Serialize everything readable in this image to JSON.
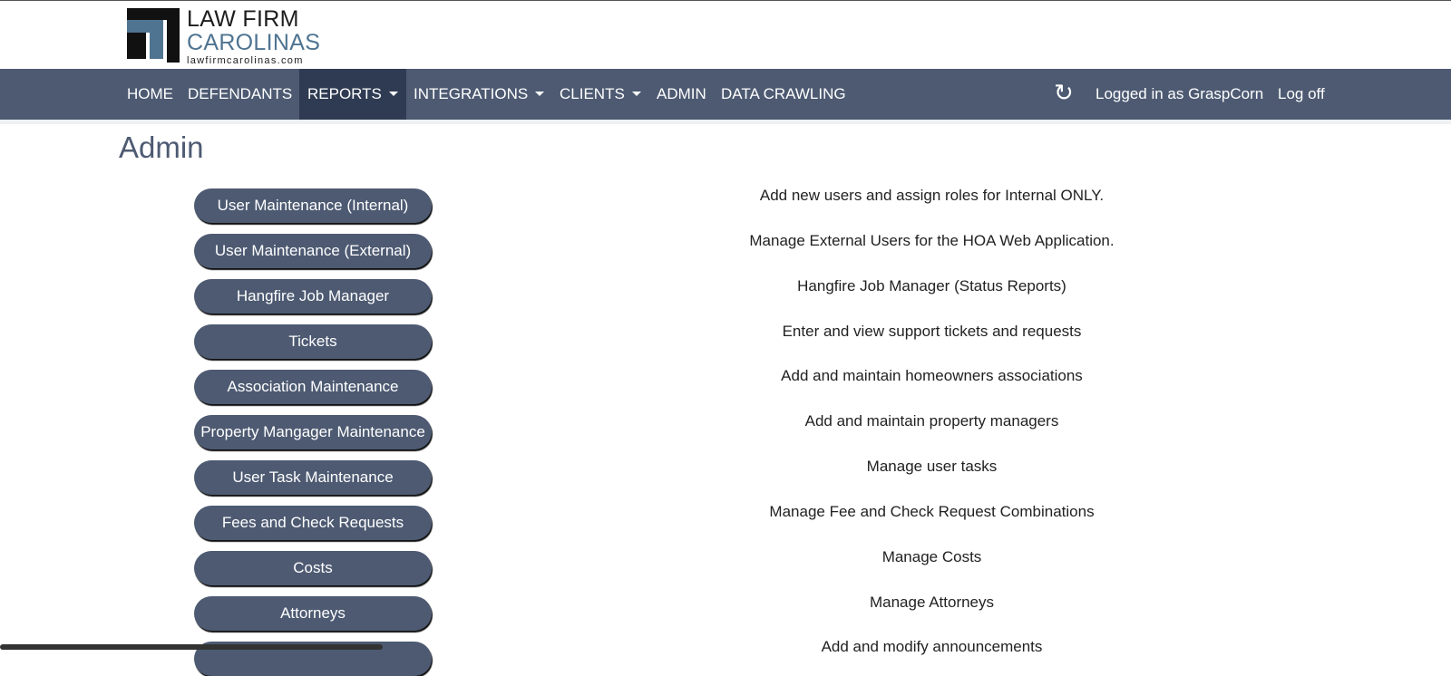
{
  "logo": {
    "line1": "LAW FIRM",
    "line2": "CAROLINAS",
    "line3": "lawfirmcarolinas.com"
  },
  "nav": {
    "items": [
      {
        "label": "HOME"
      },
      {
        "label": "DEFENDANTS"
      },
      {
        "label": "REPORTS"
      },
      {
        "label": "INTEGRATIONS"
      },
      {
        "label": "CLIENTS"
      },
      {
        "label": "ADMIN"
      },
      {
        "label": "DATA CRAWLING"
      }
    ],
    "refresh_icon": "↻",
    "logged_in": "Logged in as GraspCorn",
    "logoff": "Log off"
  },
  "page": {
    "title": "Admin"
  },
  "admin": {
    "rows": [
      {
        "button": "User Maintenance (Internal)",
        "description": "Add new users and assign roles for Internal ONLY."
      },
      {
        "button": "User Maintenance (External)",
        "description": "Manage External Users for the HOA Web Application."
      },
      {
        "button": "Hangfire Job Manager",
        "description": "Hangfire Job Manager (Status Reports)"
      },
      {
        "button": "Tickets",
        "description": "Enter and view support tickets and requests"
      },
      {
        "button": "Association Maintenance",
        "description": "Add and maintain homeowners associations"
      },
      {
        "button": "Property Mangager Maintenance",
        "description": "Add and maintain property managers"
      },
      {
        "button": "User Task Maintenance",
        "description": "Manage user tasks"
      },
      {
        "button": "Fees and Check Requests",
        "description": "Manage Fee and Check Request Combinations"
      },
      {
        "button": "Costs",
        "description": "Manage Costs"
      },
      {
        "button": "Attorneys",
        "description": "Manage Attorneys"
      },
      {
        "button": "",
        "description": "Add and modify announcements"
      }
    ]
  },
  "colors": {
    "navbar": "#4d5a72",
    "nav_active": "#2e3b52",
    "logo_blue": "#4f7491"
  }
}
